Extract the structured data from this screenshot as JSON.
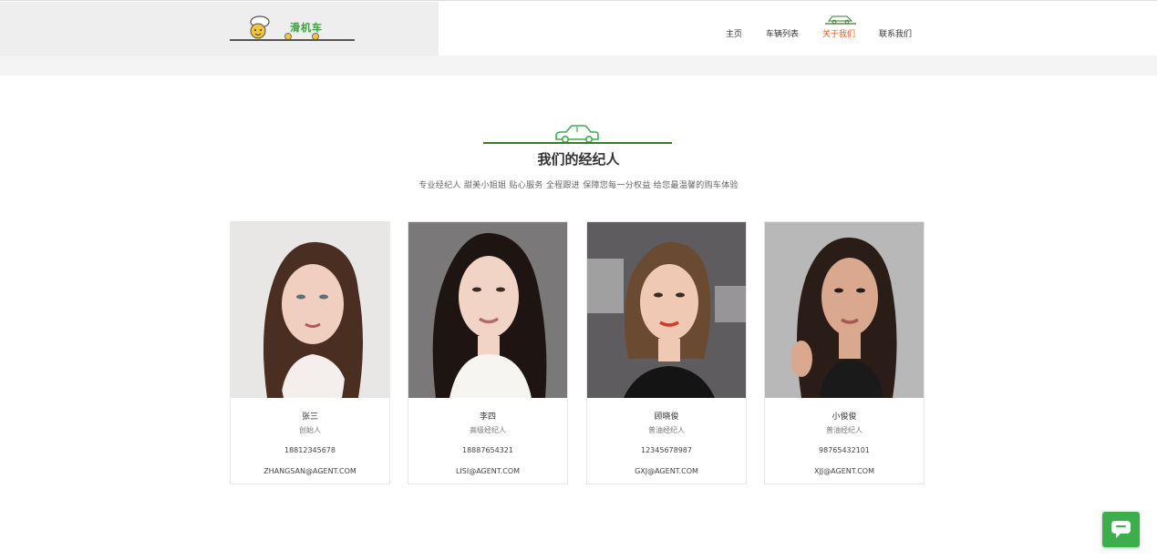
{
  "header": {
    "logo_text": "滑机车",
    "nav": [
      {
        "label": "主页",
        "active": false
      },
      {
        "label": "车辆列表",
        "active": false
      },
      {
        "label": "关于我们",
        "active": true
      },
      {
        "label": "联系我们",
        "active": false
      }
    ],
    "active_color": "#e55a2b"
  },
  "section": {
    "title": "我们的经纪人",
    "subtitle": "专业经纪人 甜美小姐姐 贴心服务 全程跟进 保障您每一分权益 给您最温馨的购车体验"
  },
  "agents": [
    {
      "name": "张三",
      "role": "创始人",
      "phone": "18812345678",
      "email": "ZHANGSAN@AGENT.COM",
      "photo": "portrait-woman-icon"
    },
    {
      "name": "李四",
      "role": "高级经纪人",
      "phone": "18887654321",
      "email": "LISI@AGENT.COM",
      "photo": "portrait-woman-icon"
    },
    {
      "name": "顾晓俊",
      "role": "普油经纪人",
      "phone": "12345678987",
      "email": "GXJ@AGENT.COM",
      "photo": "portrait-woman-icon"
    },
    {
      "name": "小俊俊",
      "role": "普油经纪人",
      "phone": "98765432101",
      "email": "XJJ@AGENT.COM",
      "photo": "portrait-woman-icon"
    }
  ],
  "colors": {
    "brand_green": "#3cae4b",
    "title_line": "#3a7a2a",
    "accent_orange": "#e55a2b"
  }
}
